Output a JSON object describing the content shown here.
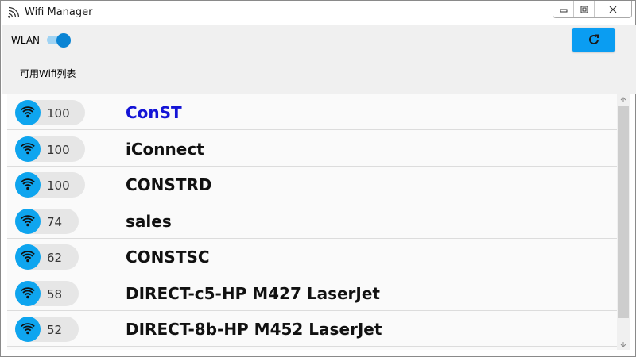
{
  "window": {
    "title": "Wifi Manager"
  },
  "controls": {
    "wlan_label": "WLAN",
    "wlan_enabled": true,
    "section_label": "可用Wifi列表"
  },
  "colors": {
    "accent": "#0a9df2",
    "signal_circle": "#0ea5ef",
    "selected_ssid": "#1414d6"
  },
  "networks": [
    {
      "signal": "100",
      "ssid": "ConST",
      "selected": true
    },
    {
      "signal": "100",
      "ssid": "iConnect",
      "selected": false
    },
    {
      "signal": "100",
      "ssid": "CONSTRD",
      "selected": false
    },
    {
      "signal": "74",
      "ssid": "sales",
      "selected": false
    },
    {
      "signal": "62",
      "ssid": "CONSTSC",
      "selected": false
    },
    {
      "signal": "58",
      "ssid": "DIRECT-c5-HP M427 LaserJet",
      "selected": false
    },
    {
      "signal": "52",
      "ssid": "DIRECT-8b-HP M452 LaserJet",
      "selected": false
    }
  ],
  "icons": {
    "app": "wifi-signal-icon",
    "minimize": "minimize-icon",
    "maximize": "restore-icon",
    "close": "close-icon",
    "refresh": "refresh-icon",
    "network": "wifi-icon",
    "scroll_up": "scroll-up-arrow-icon",
    "scroll_down": "scroll-down-arrow-icon"
  }
}
